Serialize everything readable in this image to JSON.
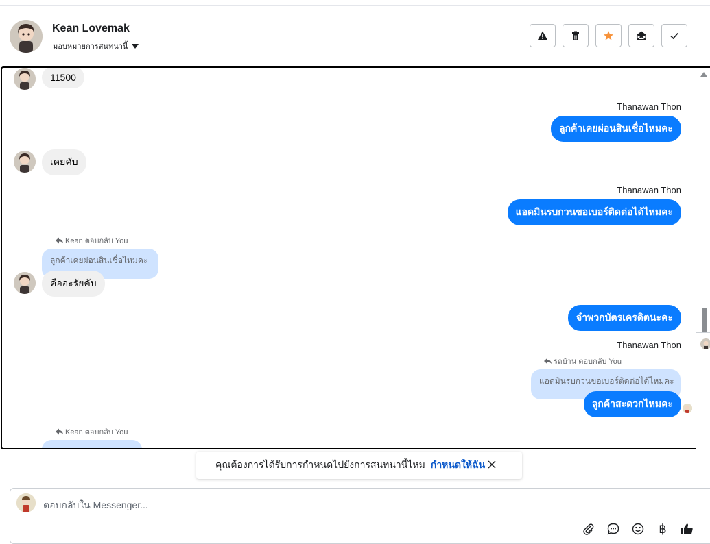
{
  "header": {
    "contact_name": "Kean Lovemak",
    "assign_label": "มอบหมายการสนทนานี้",
    "actions": [
      {
        "name": "spam",
        "icon": "warning-icon"
      },
      {
        "name": "delete",
        "icon": "trash-icon"
      },
      {
        "name": "follow-up",
        "icon": "star-icon",
        "color": "#f7923a"
      },
      {
        "name": "mark-unread",
        "icon": "envelope-open-icon"
      },
      {
        "name": "mark-done",
        "icon": "check-icon"
      }
    ]
  },
  "messages": {
    "m1": {
      "text": "11500"
    },
    "m2": {
      "sender": "Thanawan Thon",
      "text": "ลูกค้าเคยผ่อนสินเชื่อไหมคะ"
    },
    "m3": {
      "text": "เคยคับ"
    },
    "m4": {
      "sender": "Thanawan Thon",
      "text": "แอดมินรบกวนขอเบอร์ติดต่อได้ไหมคะ"
    },
    "m5": {
      "reply_hint": "Kean ตอบกลับ You",
      "quoted": "ลูกค้าเคยผ่อนสินเชื่อไหมคะ",
      "text": "คืออะรัยคับ"
    },
    "m6": {
      "text": "จำพวกบัตรเครดิตนะคะ"
    },
    "m7": {
      "sender": "Thanawan Thon",
      "reply_hint": "รถบ้าน ตอบกลับ You",
      "quoted": "แอดมินรบกวนขอเบอร์ติดต่อได้ไหมคะ",
      "text": "ลูกค้าสะดวกไหมคะ"
    },
    "m8": {
      "reply_hint": "Kean ตอบกลับ You"
    }
  },
  "toast": {
    "question": "คุณต้องการได้รับการกำหนดไปยังการสนทนานี้ไหม",
    "link": "กำหนดให้ฉัน"
  },
  "composer": {
    "placeholder": "ตอบกลับใน Messenger...",
    "currency_symbol": "฿"
  },
  "colors": {
    "outgoing_bubble": "#0a7cff",
    "incoming_bubble": "#f0f0f0",
    "quote_bubble": "#cfe3ff",
    "link": "#0a58ca"
  }
}
